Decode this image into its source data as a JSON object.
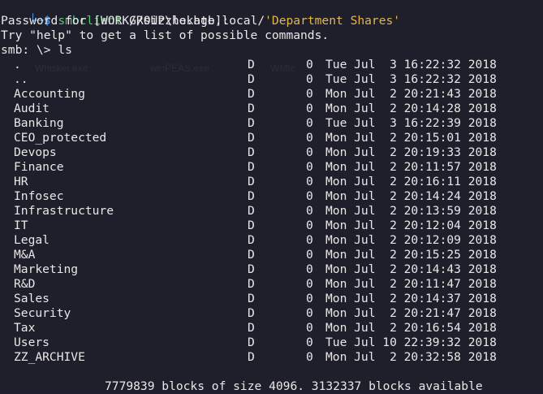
{
  "prompt": {
    "corner": "└─",
    "symbol": "$",
    "command": "smbclient",
    "target_prefix": "//sizzle.htb.local/",
    "target_share": "'Department Shares'"
  },
  "output": {
    "password_line": "Password for [WORKGROUP\\hokage]:",
    "help_line": "Try \"help\" to get a list of possible commands.",
    "smb_prompt": "smb: \\> ls"
  },
  "background_watermark": [
    "Whisker.exe",
    "winPEAS.exe",
    "WMIc"
  ],
  "listing": [
    {
      "name": ".",
      "attr": "D",
      "size": "0",
      "date": "Tue Jul  3 16:22:32 2018"
    },
    {
      "name": "..",
      "attr": "D",
      "size": "0",
      "date": "Tue Jul  3 16:22:32 2018"
    },
    {
      "name": "Accounting",
      "attr": "D",
      "size": "0",
      "date": "Mon Jul  2 20:21:43 2018"
    },
    {
      "name": "Audit",
      "attr": "D",
      "size": "0",
      "date": "Mon Jul  2 20:14:28 2018"
    },
    {
      "name": "Banking",
      "attr": "D",
      "size": "0",
      "date": "Tue Jul  3 16:22:39 2018"
    },
    {
      "name": "CEO_protected",
      "attr": "D",
      "size": "0",
      "date": "Mon Jul  2 20:15:01 2018"
    },
    {
      "name": "Devops",
      "attr": "D",
      "size": "0",
      "date": "Mon Jul  2 20:19:33 2018"
    },
    {
      "name": "Finance",
      "attr": "D",
      "size": "0",
      "date": "Mon Jul  2 20:11:57 2018"
    },
    {
      "name": "HR",
      "attr": "D",
      "size": "0",
      "date": "Mon Jul  2 20:16:11 2018"
    },
    {
      "name": "Infosec",
      "attr": "D",
      "size": "0",
      "date": "Mon Jul  2 20:14:24 2018"
    },
    {
      "name": "Infrastructure",
      "attr": "D",
      "size": "0",
      "date": "Mon Jul  2 20:13:59 2018"
    },
    {
      "name": "IT",
      "attr": "D",
      "size": "0",
      "date": "Mon Jul  2 20:12:04 2018"
    },
    {
      "name": "Legal",
      "attr": "D",
      "size": "0",
      "date": "Mon Jul  2 20:12:09 2018"
    },
    {
      "name": "M&A",
      "attr": "D",
      "size": "0",
      "date": "Mon Jul  2 20:15:25 2018"
    },
    {
      "name": "Marketing",
      "attr": "D",
      "size": "0",
      "date": "Mon Jul  2 20:14:43 2018"
    },
    {
      "name": "R&D",
      "attr": "D",
      "size": "0",
      "date": "Mon Jul  2 20:11:47 2018"
    },
    {
      "name": "Sales",
      "attr": "D",
      "size": "0",
      "date": "Mon Jul  2 20:14:37 2018"
    },
    {
      "name": "Security",
      "attr": "D",
      "size": "0",
      "date": "Mon Jul  2 20:21:47 2018"
    },
    {
      "name": "Tax",
      "attr": "D",
      "size": "0",
      "date": "Mon Jul  2 20:16:54 2018"
    },
    {
      "name": "Users",
      "attr": "D",
      "size": "0",
      "date": "Tue Jul 10 22:39:32 2018"
    },
    {
      "name": "ZZ_ARCHIVE",
      "attr": "D",
      "size": "0",
      "date": "Mon Jul  2 20:32:58 2018"
    }
  ],
  "footer": {
    "blocks_line": "7779839 blocks of size 4096. 3132337 blocks available"
  },
  "colors": {
    "background": "#1f1f2b",
    "prompt_blue": "#3f8fe0",
    "command_green": "#4fd06a",
    "string_yellow": "#e4b64c",
    "text": "#e8e8e8"
  }
}
